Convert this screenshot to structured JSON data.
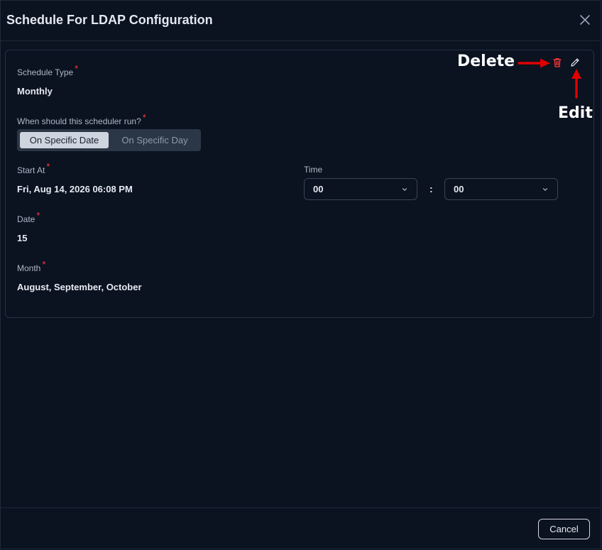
{
  "dialog": {
    "title": "Schedule For LDAP Configuration",
    "close_icon": "close-icon"
  },
  "form": {
    "schedule_type": {
      "label": "Schedule Type",
      "required": "*",
      "value": "Monthly"
    },
    "run_mode": {
      "label": "When should this scheduler run?",
      "required": "*",
      "options": [
        "On Specific Date",
        "On Specific Day"
      ],
      "selected": "On Specific Date"
    },
    "start_at": {
      "label": "Start At",
      "required": "*",
      "value": "Fri, Aug 14, 2026 06:08 PM"
    },
    "time": {
      "label": "Time",
      "hour": "00",
      "separator": ":",
      "minute": "00"
    },
    "date": {
      "label": "Date",
      "required": "*",
      "value": "15"
    },
    "month": {
      "label": "Month",
      "required": "*",
      "value": "August, September, October"
    }
  },
  "actions": {
    "delete_icon": "trash-icon",
    "edit_icon": "pencil-icon"
  },
  "annotations": {
    "delete": "Delete",
    "edit": "Edit"
  },
  "footer": {
    "cancel_label": "Cancel"
  },
  "colors": {
    "background": "#0b1220",
    "danger": "#ff3b3b",
    "annotation_arrow": "#e00000"
  }
}
